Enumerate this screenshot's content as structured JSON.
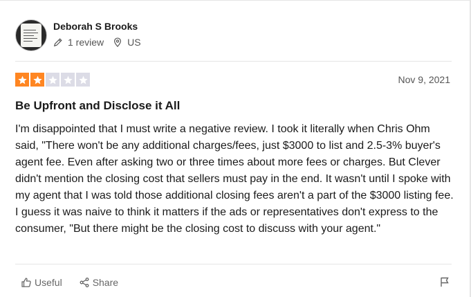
{
  "reviewer": {
    "name": "Deborah S Brooks",
    "review_count": "1 review",
    "location": "US",
    "icons": {
      "reviews": "pencil-icon",
      "location": "location-pin-icon"
    }
  },
  "rating": {
    "value": 2,
    "max": 5,
    "filled_color": "#ff8622",
    "empty_color": "#dcdce6"
  },
  "date": "Nov 9, 2021",
  "review": {
    "title": "Be Upfront and Disclose it All",
    "body": "I'm disappointed that I must write a negative review. I took it literally when Chris Ohm said, \"There won't be any additional charges/fees, just $3000 to list and 2.5-3% buyer's agent fee. Even after asking two or three times about more fees or charges. But Clever didn't mention the closing cost that sellers must pay in the end. It wasn't until I spoke with my agent that I was told those additional closing fees aren't a part of the $3000 listing fee. I guess it was naive to think it matters if the ads or representatives don't express to the consumer, \"But there might be the closing cost to discuss with your agent.\""
  },
  "actions": {
    "useful_label": "Useful",
    "share_label": "Share",
    "icons": {
      "useful": "thumbs-up-icon",
      "share": "share-icon",
      "report": "flag-icon"
    }
  }
}
